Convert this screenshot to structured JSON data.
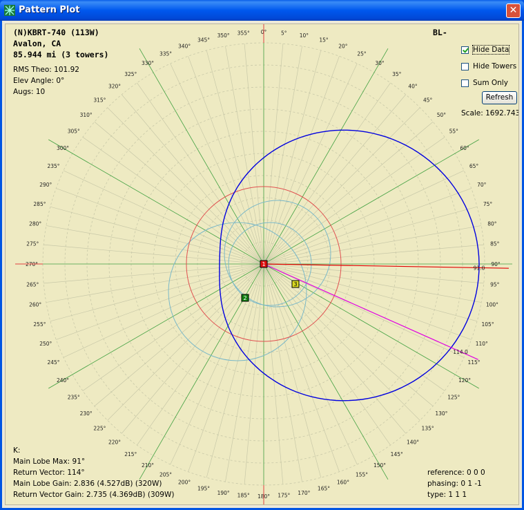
{
  "window": {
    "title": "Pattern Plot",
    "close_label": "✕"
  },
  "station": {
    "callsign_line": "(N)KBRT-740 (113W)",
    "location": "Avalon, CA",
    "distance": "85.944 mi (3 towers)",
    "class_code": "BL-"
  },
  "stats": {
    "rms": "RMS Theo: 101.92",
    "elev": "Elev Angle: 0°",
    "augs": "Augs: 10"
  },
  "controls": {
    "hide_data": {
      "label": "Hide Data",
      "checked": true
    },
    "hide_towers": {
      "label": "Hide Towers",
      "checked": false
    },
    "sum_only": {
      "label": "Sum Only",
      "checked": false
    },
    "refresh_label": "Refresh",
    "scale": "Scale: 1692.743"
  },
  "bottom_left": {
    "k": "K:",
    "main_lobe_max": "Main Lobe Max: 91°",
    "return_vector": "Return Vector: 114°",
    "main_lobe_gain": "Main Lobe Gain: 2.836 (4.527dB) (320W)",
    "return_vector_gain": "Return Vector Gain: 2.735 (4.369dB) (309W)"
  },
  "bottom_right": {
    "reference": "reference:   0 0 0",
    "phasing": "phasing:   0 1 -1",
    "type": "type:   1 1 1"
  },
  "chart_data": {
    "type": "polar",
    "angle_labels": [
      "0",
      "5",
      "10",
      "15",
      "20",
      "25",
      "30",
      "35",
      "40",
      "45",
      "50",
      "55",
      "60",
      "65",
      "70",
      "75",
      "80",
      "85",
      "90",
      "95",
      "100",
      "105",
      "110",
      "115",
      "120",
      "125",
      "130",
      "135",
      "140",
      "145",
      "150",
      "155",
      "160",
      "165",
      "170",
      "175",
      "180",
      "185",
      "190",
      "195",
      "200",
      "205",
      "210",
      "215",
      "220",
      "225",
      "230",
      "235",
      "240",
      "245",
      "250",
      "255",
      "260",
      "265",
      "270",
      "275",
      "280",
      "285",
      "290",
      "235",
      "300",
      "305",
      "310",
      "315",
      "320",
      "325",
      "330",
      "335",
      "340",
      "345",
      "350",
      "355"
    ],
    "main_lobe_azimuth": 91,
    "return_vector_azimuth": 114,
    "marker_labels": {
      "main": "91.0",
      "return": "114.0"
    },
    "towers": [
      {
        "id": "1",
        "color": "#E01010"
      },
      {
        "id": "2",
        "color": "#108010"
      },
      {
        "id": "3",
        "color": "#D8D820"
      }
    ],
    "colors": {
      "pattern": "#0000E0",
      "rms_circle": "#E05050",
      "main_line": "#E00000",
      "return_line": "#E000E0",
      "grid": "#C8C8A8",
      "major_grid": "#40A040",
      "ring": "#7AB8C8"
    }
  }
}
